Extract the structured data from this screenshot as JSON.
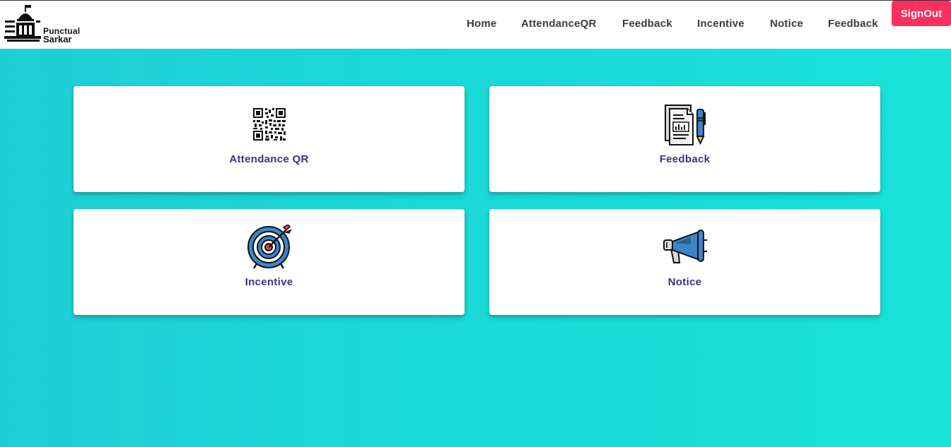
{
  "brand": {
    "line1": "Punctual",
    "line2": "Sarkar"
  },
  "nav": {
    "items": [
      {
        "label": "Home"
      },
      {
        "label": "AttendanceQR"
      },
      {
        "label": "Feedback"
      },
      {
        "label": "Incentive"
      },
      {
        "label": "Notice"
      },
      {
        "label": "Feedback"
      }
    ],
    "signout_label": "SignOut"
  },
  "cards": [
    {
      "label": "Attendance QR",
      "icon": "qr-code-icon"
    },
    {
      "label": "Feedback",
      "icon": "document-pen-icon"
    },
    {
      "label": "Incentive",
      "icon": "target-icon"
    },
    {
      "label": "Notice",
      "icon": "megaphone-icon"
    }
  ],
  "colors": {
    "background_start": "#1fcfd6",
    "background_end": "#19e2d9",
    "signout": "#ff2e5f",
    "card_label": "#3f2f7f",
    "nav_text": "#3b3b3b"
  }
}
